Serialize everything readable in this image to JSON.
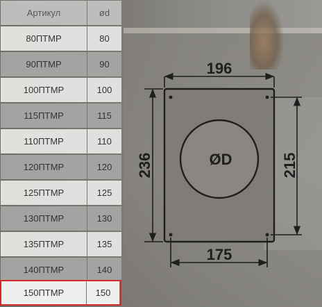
{
  "table": {
    "header": {
      "article": "Артикул",
      "diameter": "ød"
    },
    "rows": [
      {
        "article": "80ПТМР",
        "diameter": "80"
      },
      {
        "article": "90ПТМР",
        "diameter": "90"
      },
      {
        "article": "100ПТМР",
        "diameter": "100"
      },
      {
        "article": "115ПТМР",
        "diameter": "115"
      },
      {
        "article": "110ПТМР",
        "diameter": "110"
      },
      {
        "article": "120ПТМР",
        "diameter": "120"
      },
      {
        "article": "125ПТМР",
        "diameter": "125"
      },
      {
        "article": "130ПТМР",
        "diameter": "130"
      },
      {
        "article": "135ПТМР",
        "diameter": "135"
      },
      {
        "article": "140ПТМР",
        "diameter": "140"
      },
      {
        "article": "150ПТМР",
        "diameter": "150"
      }
    ],
    "highlighted_row": 10,
    "highlight_color": "#d62a2a"
  },
  "drawing": {
    "width_top": "196",
    "width_bottom": "175",
    "height_left": "236",
    "height_right": "215",
    "hole_label": "ØD"
  }
}
